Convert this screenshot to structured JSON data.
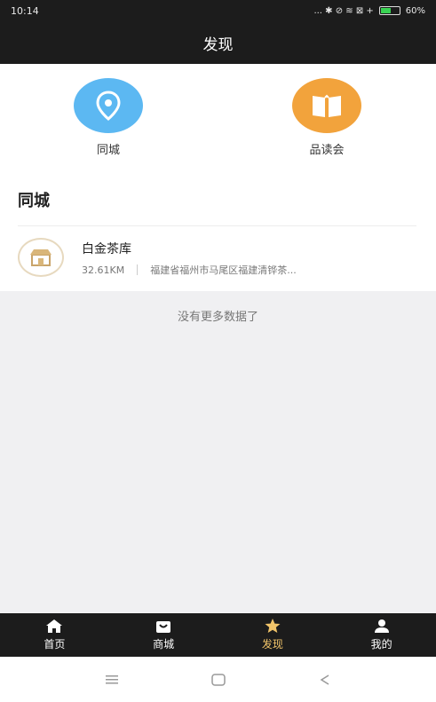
{
  "status_bar": {
    "time": "10:14",
    "indicators": "... ✱ ⊘ ≋ ⊠ +",
    "battery_percent": "60%",
    "battery_level": 0.6
  },
  "header": {
    "title": "发现"
  },
  "shortcuts": [
    {
      "label": "同城",
      "icon": "location-pin-icon",
      "color": "#5cb8f2"
    },
    {
      "label": "品读会",
      "icon": "open-book-icon",
      "color": "#f2a33c"
    }
  ],
  "section": {
    "title": "同城"
  },
  "shops": [
    {
      "name": "白金茶库",
      "distance": "32.61KM",
      "address": "福建省福州市马尾区福建清铧茶..."
    }
  ],
  "list_footer": "没有更多数据了",
  "tabs": [
    {
      "label": "首页",
      "icon": "home-icon",
      "active": false
    },
    {
      "label": "商城",
      "icon": "shopping-bag-icon",
      "active": false
    },
    {
      "label": "发现",
      "icon": "star-icon",
      "active": true
    },
    {
      "label": "我的",
      "icon": "user-icon",
      "active": false
    }
  ],
  "colors": {
    "bar_dark": "#1c1c1c",
    "tab_active": "#f2c56a"
  }
}
